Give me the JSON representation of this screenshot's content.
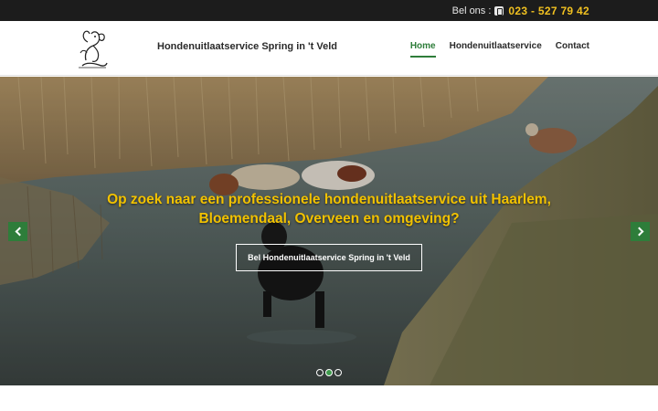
{
  "topbar": {
    "call_label": "Bel ons :",
    "phone_icon": "phone-icon",
    "phone_number": "023 - 527 79 42",
    "phone_color": "#f0c020"
  },
  "header": {
    "logo_icon": "dog-logo-icon",
    "brand": "Hondenuitlaatservice Spring in 't Veld",
    "nav": [
      {
        "label": "Home",
        "active": true
      },
      {
        "label": "Hondenuitlaatservice",
        "active": false
      },
      {
        "label": "Contact",
        "active": false
      }
    ],
    "accent_color": "#2e7d3a"
  },
  "hero": {
    "headline_line1": "Op zoek naar een professionele hondenuitlaatservice uit Haarlem,",
    "headline_line2": "Bloemendaal, Overveen en omgeving?",
    "headline_color": "#f2c200",
    "cta_label": "Bel Hondenuitlaatservice Spring in 't Veld",
    "prev_icon": "chevron-left-icon",
    "next_icon": "chevron-right-icon",
    "slides": 3,
    "active_slide": 2
  }
}
